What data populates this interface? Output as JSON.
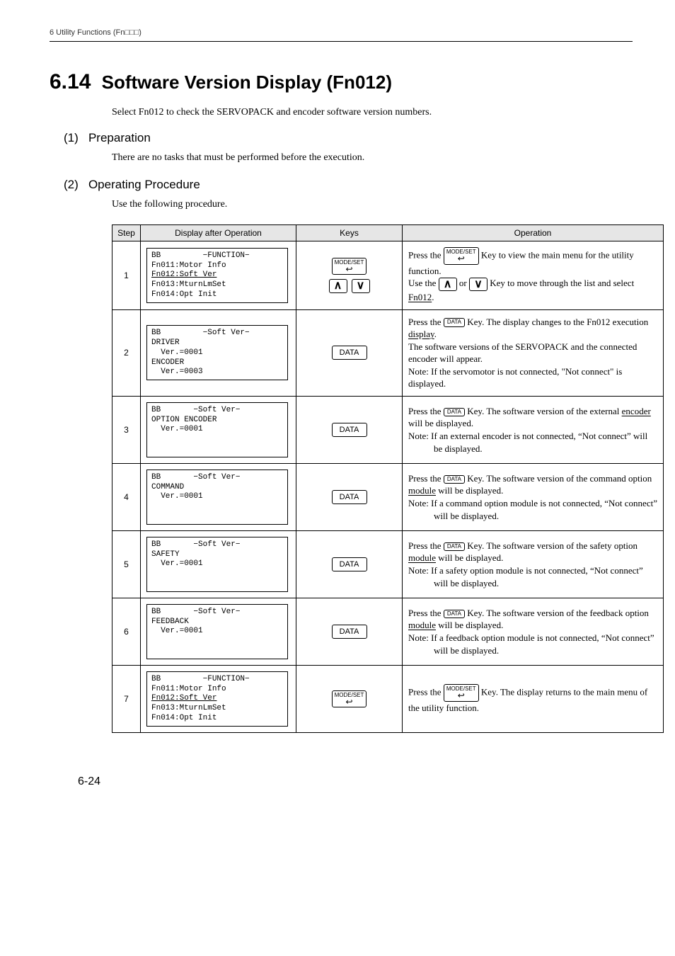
{
  "header": "6  Utility Functions (Fn□□□)",
  "section": {
    "num": "6.14",
    "title": "Software Version Display (Fn012)",
    "intro": "Select Fn012 to check the SERVOPACK and encoder software version numbers."
  },
  "sub1": {
    "num": "(1)",
    "title": "Preparation",
    "body": "There are no tasks that must be performed before the execution."
  },
  "sub2": {
    "num": "(2)",
    "title": "Operating Procedure",
    "body": "Use the following procedure."
  },
  "table": {
    "headers": {
      "step": "Step",
      "disp": "Display after Operation",
      "keys": "Keys",
      "op": "Operation"
    },
    "rows": [
      {
        "step": "1",
        "lcd_lines": [
          "BB         −FUNCTION−",
          "Fn011:Motor Info",
          "Fn012:Soft Ver",
          "Fn013:MturnLmSet",
          "Fn014:Opt Init"
        ],
        "underline_line_idx": 2,
        "keys": {
          "type": "modeset+arrows"
        },
        "op_parts": {
          "p1a": "Press the ",
          "p1b": " Key to view the main menu for the utility function.",
          "p2a": "Use the ",
          "p2b": " or ",
          "p2c": " Key to move through the list and select Fn012."
        }
      },
      {
        "step": "2",
        "lcd_lines": [
          "BB         −Soft Ver−",
          "DRIVER",
          "  Ver.=0001",
          "ENCODER",
          "  Ver.=0003"
        ],
        "keys": {
          "type": "data"
        },
        "op_parts": {
          "p1a": "Press the ",
          "p1b": " Key. The display changes to the Fn012 execution display.",
          "p2": "The software versions of the SERVOPACK and the connected encoder will appear.",
          "p3": "Note: If the servomotor is not connected, \"Not connect\" is displayed."
        }
      },
      {
        "step": "3",
        "lcd_lines": [
          "BB       −Soft Ver−",
          "OPTION ENCODER",
          "  Ver.=0001",
          "",
          ""
        ],
        "keys": {
          "type": "data"
        },
        "op_parts": {
          "p1a": "Press the ",
          "p1b": " Key. The software version of the external encoder will be displayed.",
          "note_label": "Note: ",
          "note_body": "If an external encoder is not connected, “Not connect” will be displayed."
        }
      },
      {
        "step": "4",
        "lcd_lines": [
          "BB       −Soft Ver−",
          "COMMAND",
          "  Ver.=0001",
          "",
          ""
        ],
        "keys": {
          "type": "data"
        },
        "op_parts": {
          "p1a": "Press the ",
          "p1b": " Key. The software version of the command option module will be displayed.",
          "note_label": "Note: ",
          "note_body": "If a command option module is not connected, “Not connect” will be displayed."
        }
      },
      {
        "step": "5",
        "lcd_lines": [
          "BB       −Soft Ver−",
          "SAFETY",
          "  Ver.=0001",
          "",
          ""
        ],
        "keys": {
          "type": "data"
        },
        "op_parts": {
          "p1a": "Press the ",
          "p1b": " Key. The software version of the safety option module will be displayed.",
          "note_label": "Note: ",
          "note_body": "If a safety option module is not connected, “Not connect” will be displayed."
        }
      },
      {
        "step": "6",
        "lcd_lines": [
          "BB       −Soft Ver−",
          "FEEDBACK",
          "  Ver.=0001",
          "",
          ""
        ],
        "keys": {
          "type": "data"
        },
        "op_parts": {
          "p1a": "Press the ",
          "p1b": " Key. The software version of the feedback option module will be displayed.",
          "note_label": "Note: ",
          "note_body": "If a feedback option module is not connected, “Not connect” will be displayed."
        }
      },
      {
        "step": "7",
        "lcd_lines": [
          "BB         −FUNCTION−",
          "Fn011:Motor Info",
          "Fn012:Soft Ver",
          "Fn013:MturnLmSet",
          "Fn014:Opt Init"
        ],
        "underline_line_idx": 2,
        "keys": {
          "type": "modeset"
        },
        "op_parts": {
          "p1a": "Press the ",
          "p1b": " Key. The display returns to the main menu of the utility function."
        }
      }
    ]
  },
  "key_labels": {
    "modeset_top": "MODE/SET",
    "modeset_arrow": "↩",
    "data": "DATA",
    "data_small": "DATA",
    "up": "∧",
    "down": "∨"
  },
  "footer": "6-24"
}
